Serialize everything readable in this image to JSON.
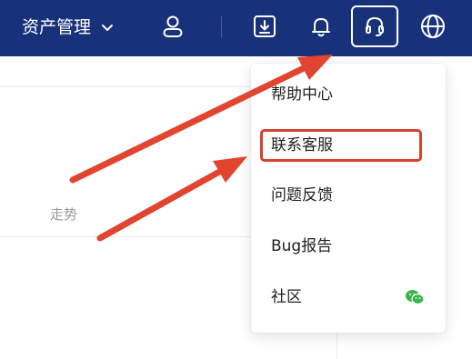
{
  "header": {
    "menu_title": "资产管理",
    "icons": [
      "user-icon",
      "download-icon",
      "bell-icon",
      "headset-icon",
      "globe-icon"
    ]
  },
  "content": {
    "trend_label": "走势"
  },
  "dropdown": {
    "items": [
      {
        "label": "帮助中心"
      },
      {
        "label": "联系客服"
      },
      {
        "label": "问题反馈"
      },
      {
        "label": "Bug报告"
      },
      {
        "label": "社区",
        "icon": "wechat-icon"
      }
    ]
  },
  "colors": {
    "topbar": "#17317a",
    "arrow": "#e1452f",
    "highlight": "#d6402c",
    "wechat": "#3ab54a"
  }
}
